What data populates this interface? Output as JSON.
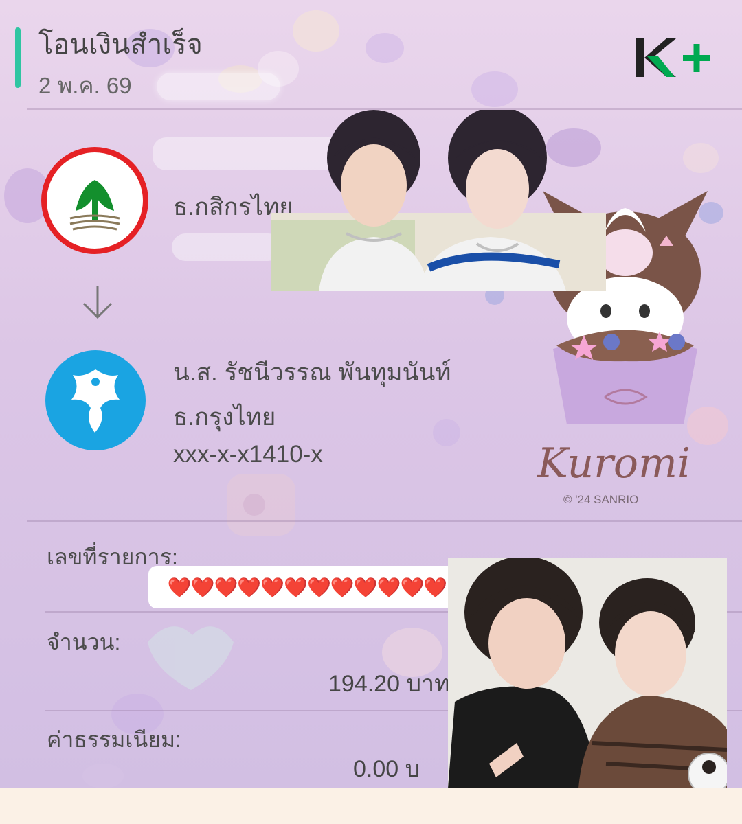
{
  "header": {
    "title": "โอนเงินสำเร็จ",
    "date": "2 พ.ค. 69"
  },
  "brand": {
    "name": "K+",
    "accent": "#2fc5a2",
    "green": "#00a950"
  },
  "sender": {
    "bank": "ธ.กสิกรไทย",
    "logo": "kbank-logo",
    "logo_color": "#138f2d"
  },
  "recipient": {
    "name": "น.ส. รัชนีวรรณ พันทุมนันท์",
    "bank": "ธ.กรุงไทย",
    "account": "xxx-x-x1410-x",
    "logo": "ktb-logo",
    "logo_color": "#1aa4e2"
  },
  "transaction": {
    "ref_label": "เลขที่รายการ:",
    "ref_value": "❤️❤️❤️❤️❤️❤️❤️❤️❤️❤️❤️❤️",
    "amount_label": "จำนวน:",
    "amount_value": "194.20 บาท",
    "fee_label": "ค่าธรรมเนียม:",
    "fee_value": "0.00 บ"
  },
  "sticker": {
    "brand_text": "Kuromi",
    "copyright": "© '24 SANRIO"
  }
}
